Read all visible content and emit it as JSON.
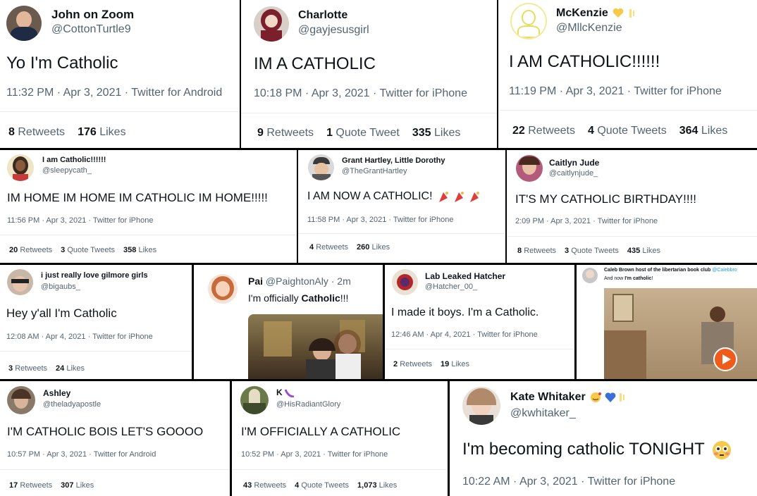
{
  "tweets": [
    {
      "name": "John on Zoom",
      "handle": "@CottonTurtle9",
      "text": "Yo I'm Catholic",
      "meta": "11:32 PM · Apr 3, 2021 · Twitter for Android",
      "retweets": "8",
      "quotes": "",
      "likes": "176"
    },
    {
      "name": "Charlotte",
      "handle": "@gayjesusgirl",
      "text": "IM A CATHOLIC",
      "meta": "10:18 PM · Apr 3, 2021 · Twitter for iPhone",
      "retweets": "9",
      "quotes": "1",
      "likes": "335"
    },
    {
      "name": "McKenzie",
      "handle": "@MllcKenzie",
      "text": "I AM CATHOLIC!!!!!!",
      "meta": "11:19 PM · Apr 3, 2021 · Twitter for iPhone",
      "retweets": "22",
      "quotes": "4",
      "likes": "364"
    },
    {
      "name": "I am Catholic!!!!!!",
      "handle": "@sleepycath_",
      "text": "IM HOME IM HOME IM CATHOLIC IM HOME!!!!!",
      "meta": "11:56 PM · Apr 3, 2021 · Twitter for iPhone",
      "retweets": "20",
      "quotes": "3",
      "likes": "358"
    },
    {
      "name": "Grant Hartley, Little Dorothy",
      "handle": "@TheGrantHartley",
      "text": "I AM NOW A CATHOLIC!",
      "meta": "11:58 PM · Apr 3, 2021 · Twitter for iPhone",
      "retweets": "4",
      "quotes": "",
      "likes": "260"
    },
    {
      "name": "Caitlyn Jude",
      "handle": "@caitlynjude_",
      "text": "IT'S MY CATHOLIC BIRTHDAY!!!!",
      "meta": "2:09 PM · Apr 3, 2021 · Twitter for iPhone",
      "retweets": "8",
      "quotes": "3",
      "likes": "435"
    },
    {
      "name": "i just really love gilmore girls",
      "handle": "@bigaubs_",
      "text": "Hey y'all I'm Catholic",
      "meta": "12:08 AM · Apr 4, 2021 · Twitter for iPhone",
      "retweets": "3",
      "quotes": "",
      "likes": "24"
    },
    {
      "name": "Pai",
      "handle": "@PaightonAly · 2m",
      "text_a": "I'm officially ",
      "text_b": "Catholic",
      "text_c": "!!!"
    },
    {
      "name": "Lab Leaked Hatcher",
      "handle": "@Hatcher_00_",
      "text": "I made it boys. I'm a Catholic.",
      "meta": "12:46 AM · Apr 4, 2021 · Twitter for iPhone",
      "retweets": "2",
      "quotes": "",
      "likes": "19"
    },
    {
      "name": "Caleb Brown host of the libertarian book club",
      "handle": "@Calebbro",
      "text_a": "And now ",
      "text_b": "I'm catholic",
      "text_c": "!"
    },
    {
      "name": "Ashley",
      "handle": "@theladyapostle",
      "text": "I'M CATHOLIC BOIS LET'S GOOOO",
      "meta": "10:57 PM · Apr 3, 2021 · Twitter for Android",
      "retweets": "17",
      "quotes": "",
      "likes": "307"
    },
    {
      "name": "K",
      "handle": "@HisRadiantGlory",
      "text": "I'M OFFICIALLY A CATHOLIC",
      "meta": "10:52 PM · Apr 3, 2021 · Twitter for iPhone",
      "retweets": "43",
      "quotes": "4",
      "likes": "1,073"
    },
    {
      "name": "Kate Whitaker",
      "handle": "@kwhitaker_",
      "text": "I'm becoming catholic TONIGHT",
      "meta": "10:22 AM · Apr 3, 2021 · Twitter for iPhone",
      "retweets": "",
      "quotes": "",
      "likes": ""
    }
  ],
  "labels": {
    "retweets": "Retweets",
    "quote_tweet": "Quote Tweet",
    "quote_tweets": "Quote Tweets",
    "likes": "Likes"
  },
  "icons": [
    "heart-emoji",
    "party-popper-emoji",
    "flushed-face-emoji",
    "play-icon"
  ],
  "colors": {
    "text": "#0f1419",
    "secondary": "#536471",
    "link": "#1d9bf0",
    "play": "#f05a1a"
  }
}
